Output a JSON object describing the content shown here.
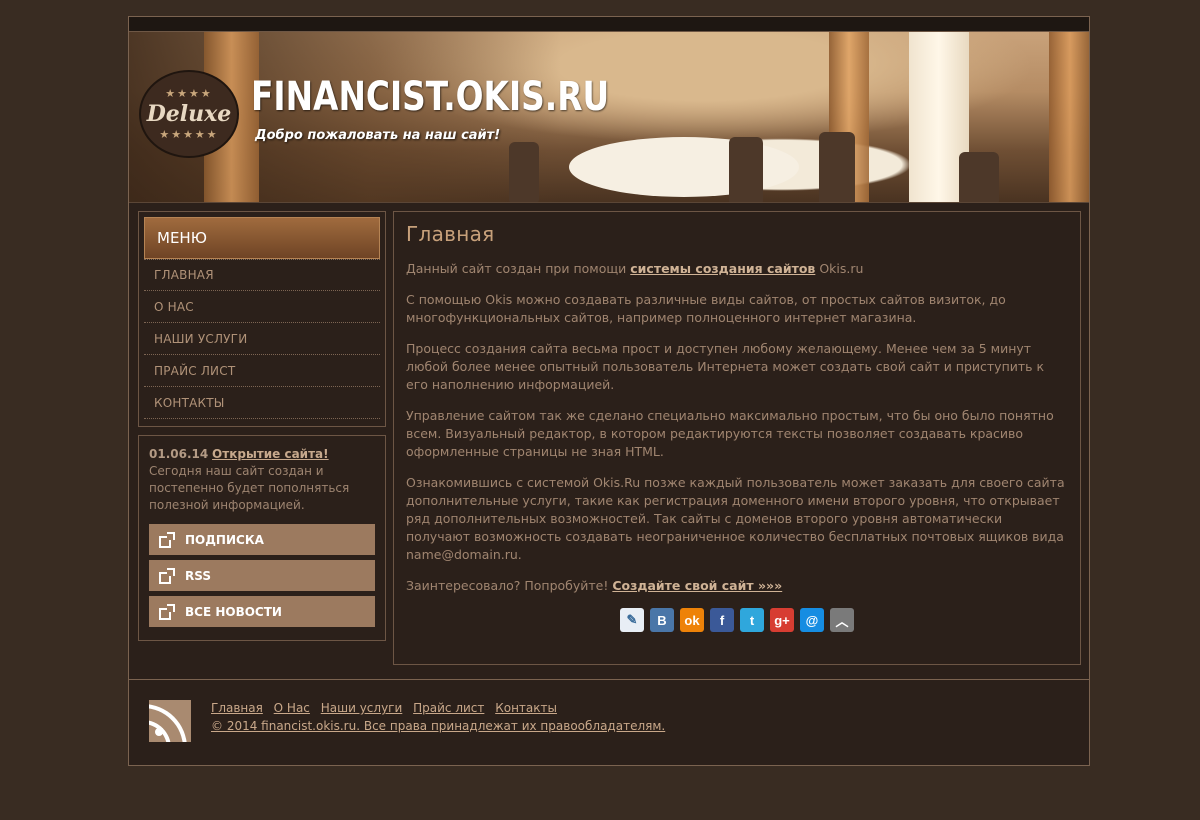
{
  "header": {
    "logo_text": "Deluxe",
    "site_title": "FINANCIST.OKIS.RU",
    "slogan": "Добро пожаловать на наш сайт!"
  },
  "menu": {
    "title": "МЕНЮ",
    "items": [
      {
        "label": "ГЛАВНАЯ"
      },
      {
        "label": "О НАС"
      },
      {
        "label": "НАШИ УСЛУГИ"
      },
      {
        "label": "ПРАЙС ЛИСТ"
      },
      {
        "label": "КОНТАКТЫ"
      }
    ]
  },
  "news": {
    "date": "01.06.14",
    "title": "Открытие сайта!",
    "text": "Сегодня наш сайт создан и постепенно будет пополняться полезной информацией."
  },
  "side_buttons": [
    {
      "label": "ПОДПИСКА"
    },
    {
      "label": "RSS"
    },
    {
      "label": "ВСЕ НОВОСТИ"
    }
  ],
  "main": {
    "title": "Главная",
    "p1_before": "Данный сайт создан при помощи ",
    "p1_link": "системы создания сайтов",
    "p1_after": " Okis.ru",
    "p2": "С помощью Okis можно создавать различные виды сайтов, от простых сайтов визиток, до многофункциональных сайтов, например полноценного интернет магазина.",
    "p3": "Процесс создания сайта весьма прост и доступен любому желающему. Менее чем за 5 минут любой более менее опытный пользователь Интернета может создать свой сайт и приступить к его наполнению информацией.",
    "p4": "Управление сайтом так же сделано специально максимально простым, что бы оно было понятно всем. Визуальный редактор, в котором редактируются тексты позволяет создавать красиво оформленные страницы не зная HTML.",
    "p5": "Ознакомившись с системой Okis.Ru позже каждый пользователь может заказать для своего сайта дополнительные услуги, такие как регистрация доменного имени второго уровня, что открывает ряд дополнительных возможностей. Так сайты с доменов второго уровня автоматически получают возможность создавать неограниченное количество бесплатных почтовых ящиков вида name@domain.ru.",
    "p6_before": "Заинтересовало? Попробуйте! ",
    "p6_link": "Создайте свой сайт »»»"
  },
  "share_icons": [
    {
      "name": "livejournal-icon",
      "glyph": "✎",
      "color": "#e8eef5"
    },
    {
      "name": "vkontakte-icon",
      "glyph": "В",
      "color": "#4a76a8"
    },
    {
      "name": "odnoklassniki-icon",
      "glyph": "ok",
      "color": "#ee8208"
    },
    {
      "name": "facebook-icon",
      "glyph": "f",
      "color": "#3b5998"
    },
    {
      "name": "twitter-icon",
      "glyph": "t",
      "color": "#2fa7dc"
    },
    {
      "name": "googleplus-icon",
      "glyph": "g+",
      "color": "#d73d32"
    },
    {
      "name": "mailru-icon",
      "glyph": "@",
      "color": "#168de2"
    },
    {
      "name": "scroll-top-icon",
      "glyph": "︿",
      "color": "#7a7a7a"
    }
  ],
  "footer": {
    "links": [
      {
        "label": "Главная"
      },
      {
        "label": "О Нас"
      },
      {
        "label": "Наши услуги"
      },
      {
        "label": "Прайс лист"
      },
      {
        "label": "Контакты"
      }
    ],
    "copyright": "© 2014 financist.okis.ru. Все права принадлежат их правообладателям."
  }
}
